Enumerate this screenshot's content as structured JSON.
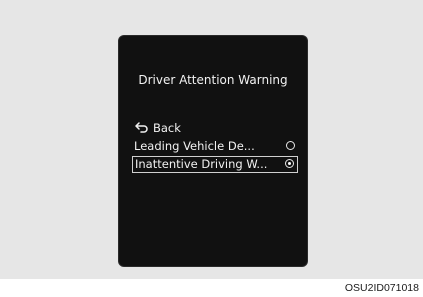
{
  "screen": {
    "title": "Driver Attention Warning",
    "back_label": "Back",
    "items": [
      {
        "label": "Leading Vehicle De...",
        "selected": false,
        "highlighted": false
      },
      {
        "label": "Inattentive Driving W...",
        "selected": true,
        "highlighted": true
      }
    ]
  },
  "caption": "OSU2ID071018",
  "icons": {
    "back": "back-arrow-icon",
    "radio_off": "radio-unselected-icon",
    "radio_on": "radio-selected-icon"
  },
  "colors": {
    "screen_bg": "#111111",
    "text": "#f2f2f2",
    "panel_bg": "#e6e6e6"
  }
}
